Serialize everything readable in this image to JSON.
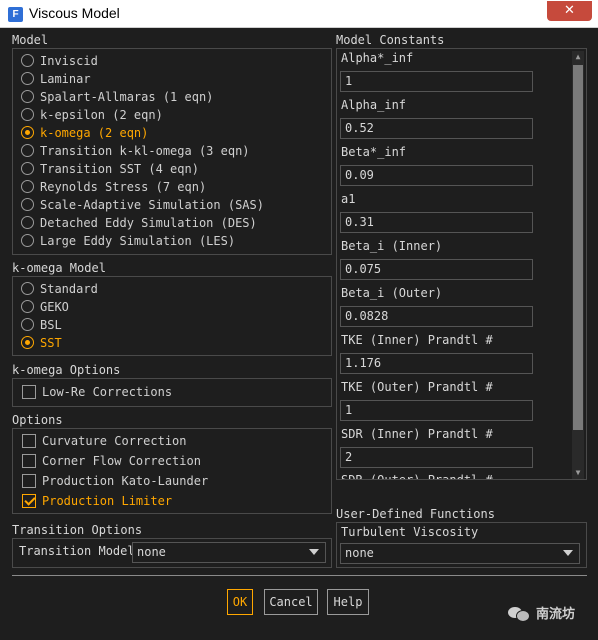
{
  "window": {
    "title": "Viscous Model",
    "app_icon": "fluent-icon",
    "close_glyph": "✕"
  },
  "model": {
    "label": "Model",
    "options": [
      {
        "label": "Inviscid",
        "selected": false
      },
      {
        "label": "Laminar",
        "selected": false
      },
      {
        "label": "Spalart-Allmaras (1 eqn)",
        "selected": false
      },
      {
        "label": "k-epsilon (2 eqn)",
        "selected": false
      },
      {
        "label": "k-omega (2 eqn)",
        "selected": true
      },
      {
        "label": "Transition k-kl-omega (3 eqn)",
        "selected": false
      },
      {
        "label": "Transition SST (4 eqn)",
        "selected": false
      },
      {
        "label": "Reynolds Stress (7 eqn)",
        "selected": false
      },
      {
        "label": "Scale-Adaptive Simulation (SAS)",
        "selected": false
      },
      {
        "label": "Detached Eddy Simulation (DES)",
        "selected": false
      },
      {
        "label": "Large Eddy Simulation (LES)",
        "selected": false
      }
    ]
  },
  "komega_model": {
    "label": "k-omega Model",
    "options": [
      {
        "label": "Standard",
        "selected": false
      },
      {
        "label": "GEKO",
        "selected": false
      },
      {
        "label": "BSL",
        "selected": false
      },
      {
        "label": "SST",
        "selected": true
      }
    ]
  },
  "komega_options": {
    "label": "k-omega Options",
    "items": [
      {
        "label": "Low-Re Corrections",
        "checked": false
      }
    ]
  },
  "options": {
    "label": "Options",
    "items": [
      {
        "label": "Curvature Correction",
        "checked": false
      },
      {
        "label": "Corner Flow Correction",
        "checked": false
      },
      {
        "label": "Production Kato-Launder",
        "checked": false
      },
      {
        "label": "Production Limiter",
        "checked": true
      }
    ]
  },
  "transition_options": {
    "label": "Transition Options",
    "model_label": "Transition Model",
    "model_value": "none"
  },
  "model_constants": {
    "label": "Model Constants",
    "items": [
      {
        "label": "Alpha*_inf",
        "value": "1"
      },
      {
        "label": "Alpha_inf",
        "value": "0.52"
      },
      {
        "label": "Beta*_inf",
        "value": "0.09"
      },
      {
        "label": "a1",
        "value": "0.31"
      },
      {
        "label": "Beta_i (Inner)",
        "value": "0.075"
      },
      {
        "label": "Beta_i (Outer)",
        "value": "0.0828"
      },
      {
        "label": "TKE (Inner) Prandtl #",
        "value": "1.176"
      },
      {
        "label": "TKE (Outer) Prandtl #",
        "value": "1"
      },
      {
        "label": "SDR (Inner) Prandtl #",
        "value": "2"
      }
    ],
    "partial_label": "SDR (Outer) Prandtl #"
  },
  "udf": {
    "label": "User-Defined Functions",
    "turb_visc_label": "Turbulent Viscosity",
    "turb_visc_value": "none"
  },
  "buttons": {
    "ok": "OK",
    "cancel": "Cancel",
    "help": "Help"
  },
  "watermark": {
    "text": "南流坊",
    "icon": "wechat-icon"
  },
  "colors": {
    "accent": "#ffa700",
    "background": "#1e1e1e",
    "close": "#c64a3c"
  }
}
